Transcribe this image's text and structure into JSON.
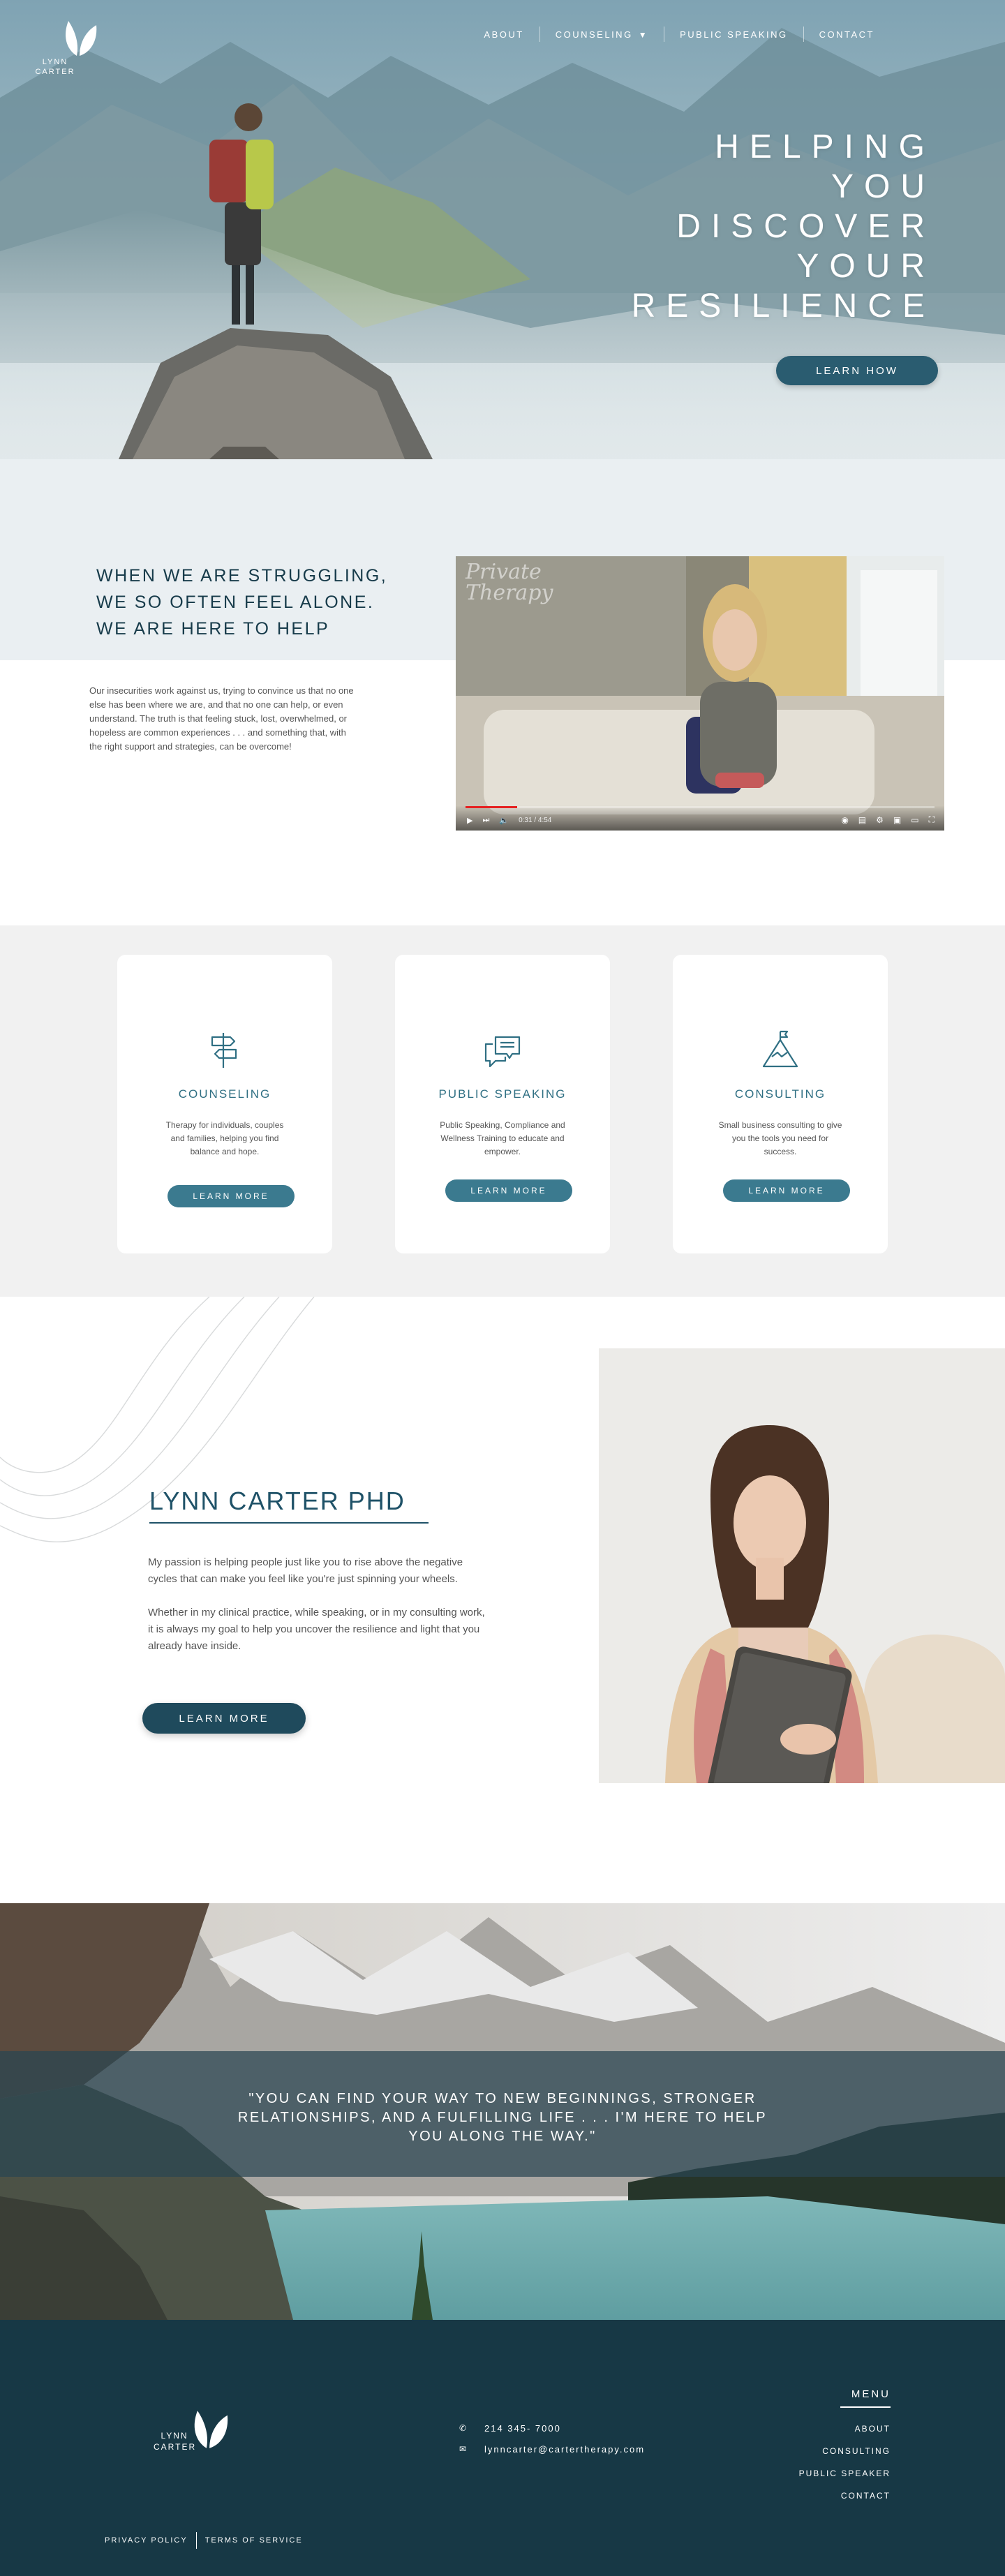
{
  "brand": {
    "name_line1": "LYNN",
    "name_line2": "CARTER"
  },
  "nav": {
    "items": [
      {
        "label": "ABOUT"
      },
      {
        "label": "COUNSELING",
        "has_dropdown": true
      },
      {
        "label": "PUBLIC SPEAKING"
      },
      {
        "label": "CONTACT"
      }
    ]
  },
  "hero": {
    "title_lines": [
      "HELPING",
      "YOU",
      "DISCOVER",
      "YOUR",
      "RESILIENCE"
    ],
    "button_label": "LEARN HOW"
  },
  "intro": {
    "heading_lines": [
      "WHEN WE ARE STRUGGLING,",
      "WE SO OFTEN FEEL ALONE.",
      "WE ARE HERE TO HELP"
    ],
    "body": "Our insecurities work against us, trying to convince us that no one else has been where we are, and that no one can help, or even understand.  The truth is that feeling stuck, lost, overwhelmed, or hopeless are common experiences . . . and something that, with the right support and strategies, can be overcome!"
  },
  "video": {
    "watermark_line1": "Private",
    "watermark_line2": "Therapy",
    "time": "0:31 / 4:54",
    "progress": 0.11
  },
  "services": [
    {
      "icon": "signpost-icon",
      "title": "COUNSELING",
      "desc": "Therapy for individuals, couples and families, helping you find balance and hope.",
      "button": "LEARN MORE"
    },
    {
      "icon": "speech-bubbles-icon",
      "title": "PUBLIC SPEAKING",
      "desc": "Public Speaking, Compliance and Wellness Training to educate and empower.",
      "button": "LEARN MORE"
    },
    {
      "icon": "mountain-flag-icon",
      "title": "CONSULTING",
      "desc": "Small business consulting to give you the tools you need for success.",
      "button": "LEARN MORE"
    }
  ],
  "about": {
    "title": "LYNN CARTER PHD",
    "p1": "My passion is helping people just like you to rise above the negative cycles that can make you feel like you're just spinning your wheels.",
    "p2": "Whether in my clinical practice, while speaking, or in my consulting work, it is always my goal to help you uncover the resilience and light that you already have inside.",
    "button": "LEARN MORE"
  },
  "quote": {
    "text": "\"YOU CAN FIND YOUR WAY TO NEW BEGINNINGS, STRONGER RELATIONSHIPS, AND A FULFILLING LIFE . . . I'M HERE TO HELP YOU ALONG THE WAY.\""
  },
  "footer": {
    "phone": "214 345- 7000",
    "email": "lynncarter@cartertherapy.com",
    "menu_heading": "MENU",
    "menu": [
      "ABOUT",
      "CONSULTING",
      "PUBLIC SPEAKER",
      "CONTACT"
    ],
    "privacy": "PRIVACY POLICY",
    "terms": "TERMS OF SERVICE"
  },
  "colors": {
    "primary": "#2d5e73",
    "heading": "#173b4a",
    "footer": "#173845",
    "accent_red": "#e52222"
  }
}
